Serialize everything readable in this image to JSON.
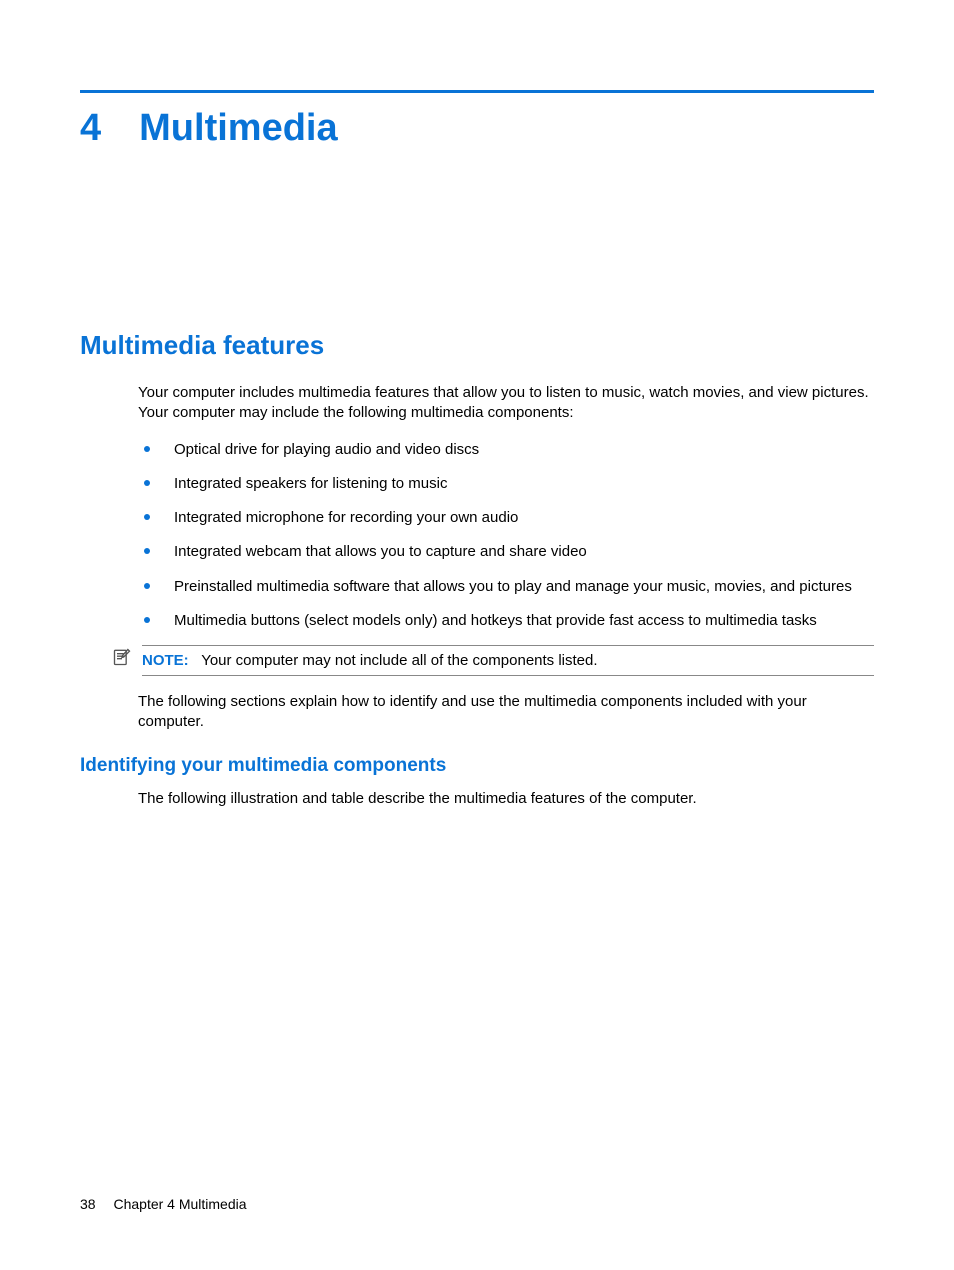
{
  "chapter": {
    "number": "4",
    "title": "Multimedia"
  },
  "section": {
    "heading": "Multimedia features",
    "intro": "Your computer includes multimedia features that allow you to listen to music, watch movies, and view pictures. Your computer may include the following multimedia components:",
    "bullets": [
      "Optical drive for playing audio and video discs",
      "Integrated speakers for listening to music",
      "Integrated microphone for recording your own audio",
      "Integrated webcam that allows you to capture and share video",
      "Preinstalled multimedia software that allows you to play and manage your music, movies, and pictures",
      "Multimedia buttons (select models only) and hotkeys that provide fast access to multimedia tasks"
    ],
    "note": {
      "label": "NOTE:",
      "text": "Your computer may not include all of the components listed."
    },
    "outro": "The following sections explain how to identify and use the multimedia components included with your computer."
  },
  "subsection": {
    "heading": "Identifying your multimedia components",
    "text": "The following illustration and table describe the multimedia features of the computer."
  },
  "footer": {
    "page": "38",
    "label": "Chapter 4   Multimedia"
  }
}
